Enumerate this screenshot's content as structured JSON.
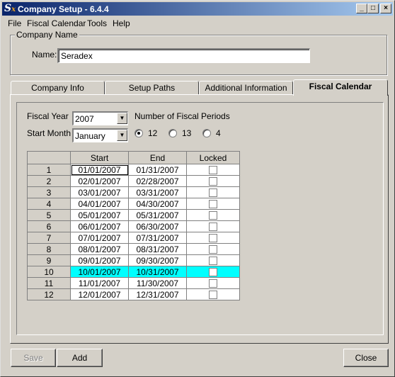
{
  "window": {
    "title": "Company Setup - 6.4.4",
    "minimize": "_",
    "maximize": "□",
    "close": "×"
  },
  "menu": [
    "File",
    "Fiscal Calendar",
    "Tools",
    "Help"
  ],
  "company": {
    "group_label": "Company Name",
    "name_label": "Name:",
    "name_value": "Seradex"
  },
  "tabs": [
    "Company Info",
    "Setup Paths",
    "Additional Information",
    "Fiscal Calendar"
  ],
  "fiscal": {
    "year_label": "Fiscal Year",
    "year_value": "2007",
    "month_label": "Start Month",
    "month_value": "January",
    "periods_label": "Number of Fiscal Periods",
    "period_options": [
      "12",
      "13",
      "4"
    ],
    "selected_period": "12"
  },
  "grid": {
    "headers": [
      "Start",
      "End",
      "Locked"
    ],
    "rows": [
      {
        "n": "1",
        "start": "01/01/2007",
        "end": "01/31/2007"
      },
      {
        "n": "2",
        "start": "02/01/2007",
        "end": "02/28/2007"
      },
      {
        "n": "3",
        "start": "03/01/2007",
        "end": "03/31/2007"
      },
      {
        "n": "4",
        "start": "04/01/2007",
        "end": "04/30/2007"
      },
      {
        "n": "5",
        "start": "05/01/2007",
        "end": "05/31/2007"
      },
      {
        "n": "6",
        "start": "06/01/2007",
        "end": "06/30/2007"
      },
      {
        "n": "7",
        "start": "07/01/2007",
        "end": "07/31/2007"
      },
      {
        "n": "8",
        "start": "08/01/2007",
        "end": "08/31/2007"
      },
      {
        "n": "9",
        "start": "09/01/2007",
        "end": "09/30/2007"
      },
      {
        "n": "10",
        "start": "10/01/2007",
        "end": "10/31/2007"
      },
      {
        "n": "11",
        "start": "11/01/2007",
        "end": "11/30/2007"
      },
      {
        "n": "12",
        "start": "12/01/2007",
        "end": "12/31/2007"
      }
    ],
    "selected_row": "10"
  },
  "buttons": {
    "save": "Save",
    "add": "Add",
    "close": "Close"
  },
  "colors": {
    "title_start": "#0a246a",
    "title_end": "#a6caf0",
    "face": "#d4d0c8",
    "selection": "#00ffff"
  }
}
